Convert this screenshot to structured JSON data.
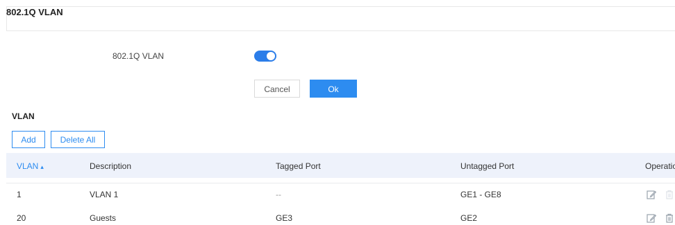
{
  "panel": {
    "title": "802.1Q VLAN"
  },
  "settings": {
    "vlan_label": "802.1Q VLAN",
    "vlan_enabled": true,
    "cancel_label": "Cancel",
    "ok_label": "Ok"
  },
  "vlan_section": {
    "title": "VLAN",
    "add_label": "Add",
    "delete_all_label": "Delete All"
  },
  "table": {
    "headers": {
      "vlan": "VLAN",
      "description": "Description",
      "tagged": "Tagged Port",
      "untagged": "Untagged Port",
      "operation": "Operatio"
    },
    "rows": [
      {
        "vlan": "1",
        "description": "VLAN 1",
        "tagged": "--",
        "untagged": "GE1 - GE8"
      },
      {
        "vlan": "20",
        "description": "Guests",
        "tagged": "GE3",
        "untagged": "GE2"
      }
    ]
  },
  "icons": {
    "sort": "sort-icon",
    "edit": "edit-icon",
    "delete": "trash-icon"
  },
  "colors": {
    "accent": "#2d8cf0",
    "toggle_on": "#2b7de9",
    "header_bg": "#eef2fb"
  }
}
